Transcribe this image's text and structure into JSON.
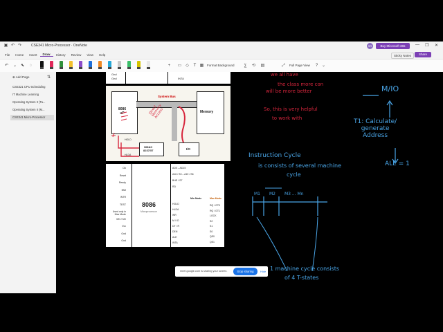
{
  "window": {
    "title": "CSE341 Micro-Processor · OneNote",
    "try_label": "Buy Microsoft 365",
    "avatar_initials": "SR",
    "minimize": "—",
    "maximize": "❐",
    "close": "✕"
  },
  "menu": {
    "items": [
      "File",
      "Home",
      "Insert",
      "Draw",
      "History",
      "Review",
      "View",
      "Help"
    ],
    "active": "Draw",
    "sticky_notes": "Sticky Notes",
    "share": "Share"
  },
  "ribbon": {
    "format_background": "Format Background",
    "full_page_view": "Full Page View",
    "pen_colors": [
      "#111111",
      "#e0285a",
      "#2f8f3a",
      "#f2c12e",
      "#8b4cc9",
      "#1e6fd9",
      "#f08a24",
      "#27a7d6",
      "#c9c9c9",
      "#3bbf6a",
      "#d6c400",
      "#e8e8e8"
    ]
  },
  "sidebar": {
    "add_page": "Add Page",
    "pages": [
      "CSE321 CPU Scheduling",
      "IT Machine Learning",
      "Operating System II (Ta...",
      "Operating System II (M...",
      "CSE341 Micro-Processor"
    ],
    "selected": 4
  },
  "slides": {
    "top_pins": [
      "Gnd",
      "Gnd",
      "INTA"
    ],
    "block": {
      "cpu": "8086\nuP",
      "memory": "Memory",
      "system_bus": "System Bus",
      "dmac": "DMAC\n8237/57",
      "io": "I/O",
      "hold": "HOLD",
      "hlda": "HLDA"
    },
    "chip": {
      "name": "8086",
      "sub": "Microprocessor",
      "left_pins": [
        "Clk",
        "Reset",
        "Ready",
        "NMI",
        "INTR",
        "TEST",
        "Used only in\nMax Mode",
        "MN / MX",
        "Vcc",
        "Gnd",
        "Gnd"
      ],
      "right_pins": [
        "AD0 – AD15",
        "A16 / S3 – A19 / S6",
        "BHE / S7",
        "RD",
        "HOLD",
        "HLDA",
        "WR",
        "M / IO",
        "DT / R",
        "DEN",
        "ALE",
        "INTA"
      ],
      "min_mode": "Min Mode",
      "max_mode": "Max Mode",
      "max_pins": [
        "RQ / GT0",
        "RQ / GT1",
        "LOCK",
        "S2",
        "S1",
        "S0",
        "QS0",
        "QS1"
      ]
    }
  },
  "annotations": {
    "red1": "we all have",
    "red2": "the class more con",
    "red3": "will be more better",
    "red4": "So, this is very helpful",
    "red5": "to work with",
    "direct_memory": "Direct\nMemory\nAccess",
    "mio": "M/IO",
    "t1": "T1: Calculate/\ngenerate\nAddress",
    "ale": "ALE = 1",
    "instr1": "Instruction Cycle",
    "instr2": "is consists of several machine",
    "instr3": "cycle",
    "m_labels": [
      "M1",
      "M2",
      "M3 ... Mn"
    ],
    "bottom1": "1 machine cycle consists",
    "bottom2": "of 4 T-states"
  },
  "share_banner": {
    "message": "meet.google.com is sharing your screen.",
    "stop": "Stop sharing",
    "hide": "Hide"
  }
}
